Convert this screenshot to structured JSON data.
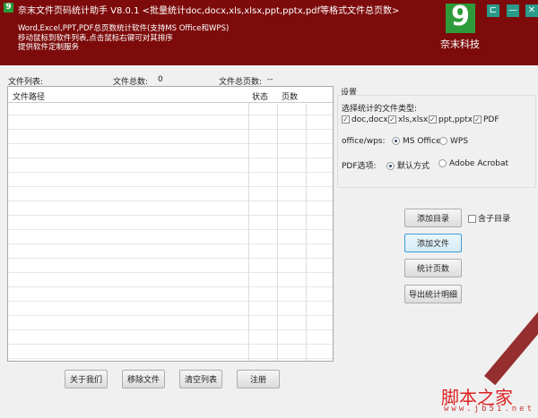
{
  "window": {
    "title": "奈末文件页码统计助手 V8.0.1 <批量统计doc,docx,xls,xlsx,ppt,pptx,pdf等格式文件总页数>",
    "icon_letter": "9",
    "pin": "⊏",
    "minimize": "—",
    "close": "✕"
  },
  "header": {
    "lines": [
      "Word,Excel,PPT,PDF总页数统计软件(支持MS Office和WPS)",
      "移动鼠标到软件列表,点击鼠标右键可对其排序",
      "提供软件定制服务"
    ],
    "logo_glyph": "9",
    "brand": "奈末科技"
  },
  "summary": {
    "list_label": "文件列表:",
    "count_label": "文件总数:",
    "count_value": "0",
    "pages_label": "文件总页数:",
    "pages_value": "--"
  },
  "table": {
    "columns": [
      "文件路径",
      "状态",
      "页数"
    ],
    "rows": []
  },
  "settings": {
    "title": "设置",
    "types_label": "选择统计的文件类型:",
    "types": [
      {
        "label": "doc,docx",
        "checked": true
      },
      {
        "label": "xls,xlsx",
        "checked": true
      },
      {
        "label": "ppt,pptx",
        "checked": true
      },
      {
        "label": "PDF",
        "checked": true
      }
    ],
    "office_label": "office/wps:",
    "office_options": [
      "MS Office",
      "WPS"
    ],
    "office_selected": "MS Office",
    "pdf_label": "PDF选项:",
    "pdf_options": [
      "默认方式",
      "Adobe Acrobat"
    ],
    "pdf_selected": "默认方式"
  },
  "actions": {
    "add_dir": "添加目录",
    "include_sub": "含子目录",
    "include_sub_checked": false,
    "add_file": "添加文件",
    "count_pages": "统计页数",
    "export": "导出统计明细"
  },
  "bottom": {
    "about": "关于我们",
    "remove": "移除文件",
    "clear": "清空列表",
    "register": "注册"
  },
  "watermark": {
    "text": "脚本之家",
    "url": "www.jb51.net"
  }
}
